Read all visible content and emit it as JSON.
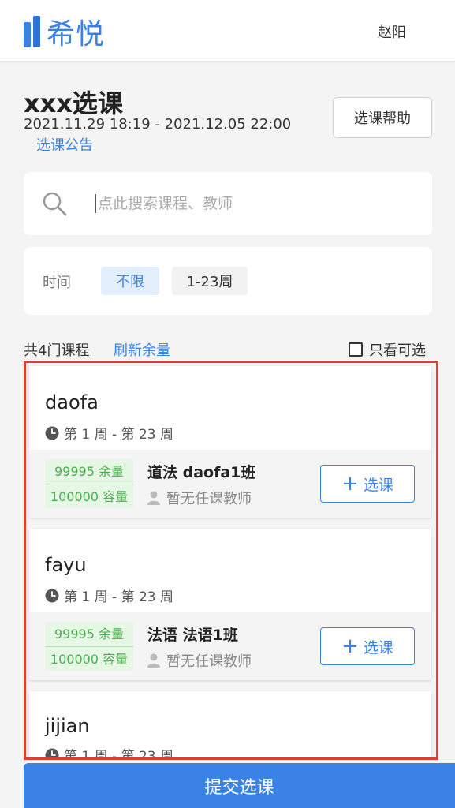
{
  "header": {
    "logo_text": "希悦",
    "username": "赵阳"
  },
  "course_selection": {
    "title": "xxx选课",
    "date_range": "2021.11.29 18:19 - 2021.12.05 22:00",
    "notice_link": "选课公告",
    "help_button": "选课帮助"
  },
  "search": {
    "placeholder": "点此搜索课程、教师",
    "value": ""
  },
  "filter": {
    "label": "时间",
    "options": [
      "不限",
      "1-23周"
    ],
    "selected": "不限"
  },
  "summary": {
    "count_text": "共4门课程",
    "refresh_link": "刷新余量",
    "only_available_label": "只看可选",
    "only_available_checked": false
  },
  "courses": [
    {
      "name": "daofa",
      "weeks": "第 1 周 - 第 23 周",
      "section": {
        "remaining": "99995 余量",
        "capacity": "100000 容量",
        "name": "道法 daofa1班",
        "teacher": "暂无任课教师",
        "button": "选课"
      }
    },
    {
      "name": "fayu",
      "weeks": "第 1 周 - 第 23 周",
      "section": {
        "remaining": "99995 余量",
        "capacity": "100000 容量",
        "name": "法语 法语1班",
        "teacher": "暂无任课教师",
        "button": "选课"
      }
    },
    {
      "name": "jijian",
      "weeks": "第 1 周 - 第 23 周"
    }
  ],
  "submit": {
    "label": "提交选课"
  },
  "colors": {
    "accent": "#3a82e6",
    "highlight_border": "#e0402f",
    "quota_green": "#4caf50",
    "quota_bg": "#e6f7e5"
  }
}
